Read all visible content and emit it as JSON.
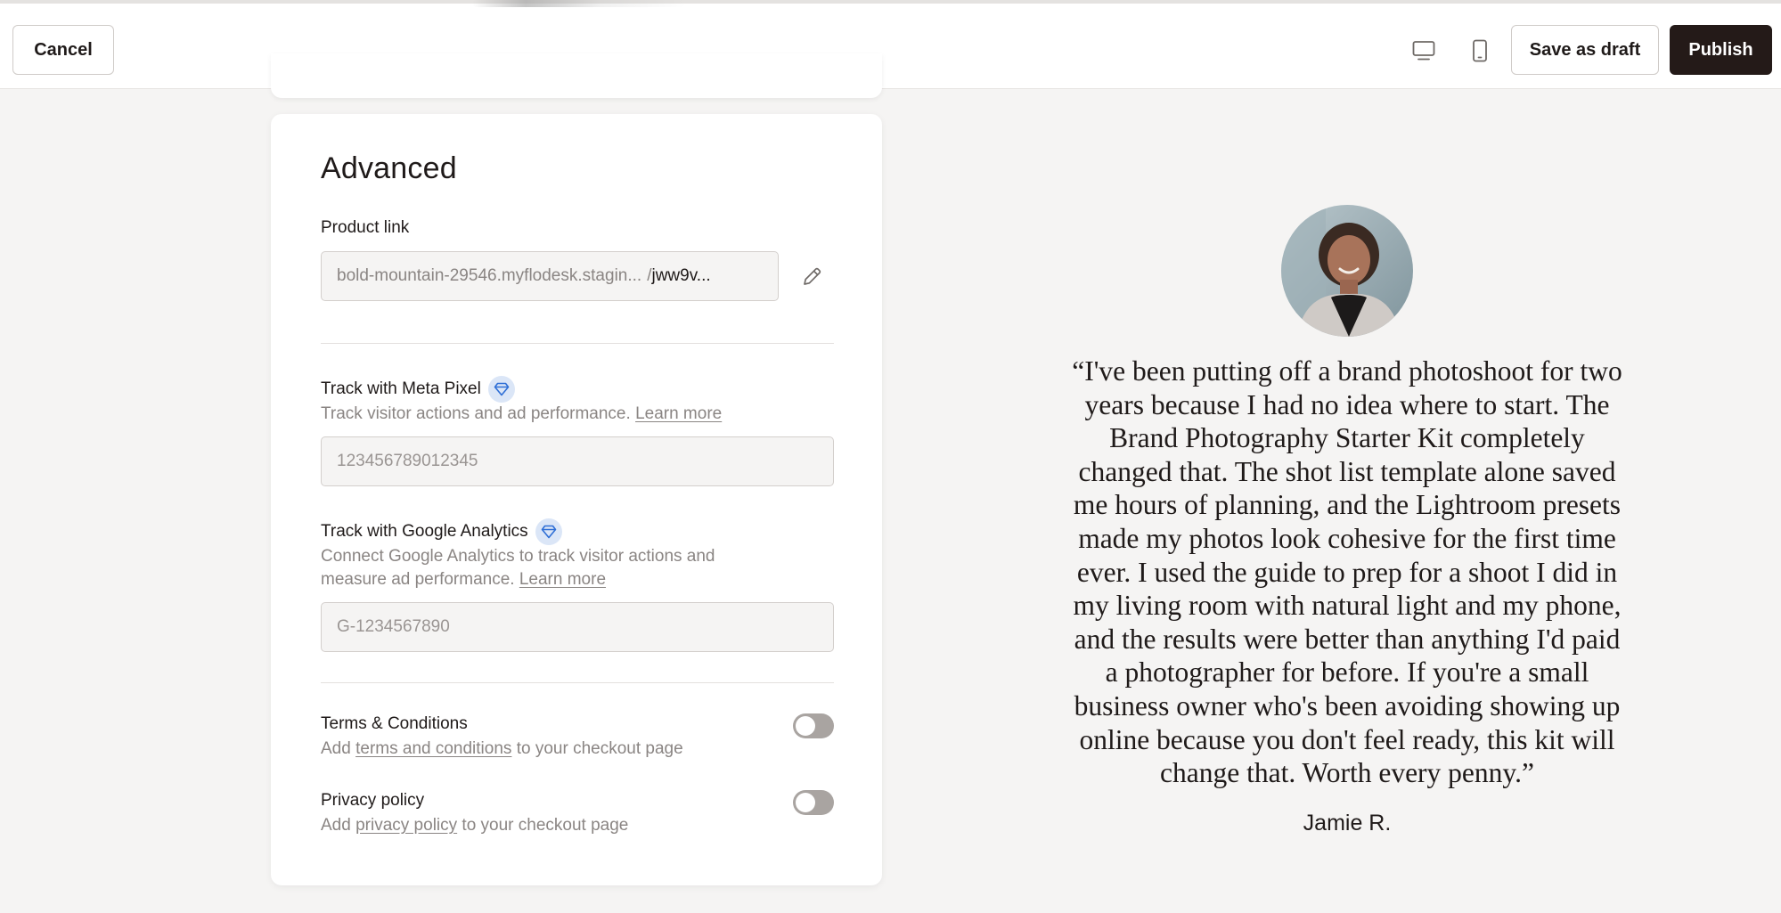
{
  "topbar": {
    "cancel_label": "Cancel",
    "save_draft_label": "Save as draft",
    "publish_label": "Publish",
    "desktop_icon": "desktop-icon",
    "mobile_icon": "mobile-icon"
  },
  "advanced": {
    "title": "Advanced",
    "product_link": {
      "label": "Product link",
      "domain": "bold-mountain-29546.myflodesk.stagin...",
      "separator": "/",
      "slug": "jww9v...",
      "edit_icon": "pencil-icon"
    },
    "meta_pixel": {
      "label": "Track with Meta Pixel",
      "badge_icon": "diamond-icon",
      "description": "Track visitor actions and ad performance.",
      "learn_more": "Learn more",
      "placeholder": "123456789012345"
    },
    "google_analytics": {
      "label": "Track with Google Analytics",
      "badge_icon": "diamond-icon",
      "description_line1": "Connect Google Analytics to track visitor actions and",
      "description_line2": "measure ad performance.",
      "learn_more": "Learn more",
      "placeholder": "G-1234567890"
    },
    "terms": {
      "label": "Terms & Conditions",
      "desc_prefix": "Add",
      "desc_link": "terms and conditions",
      "desc_suffix": "to your checkout page",
      "enabled": false
    },
    "privacy": {
      "label": "Privacy policy",
      "desc_prefix": "Add",
      "desc_link": "privacy policy",
      "desc_suffix": "to your checkout page",
      "enabled": false
    }
  },
  "preview": {
    "quote_lines": [
      "“I've been putting off a brand photoshoot for two",
      "years because I had no idea where to start. The",
      "Brand Photography Starter Kit completely",
      "changed that. The shot list template alone saved",
      "me hours of planning, and the Lightroom presets",
      "made my photos look cohesive for the first time",
      "ever. I used the guide to prep for a shoot I did in",
      "my living room with natural light and my phone,",
      "and the results were better than anything I'd paid",
      "a photographer for before. If you're a small",
      "business owner who's been avoiding showing up",
      "online because you don't feel ready, this kit will",
      "change that. Worth every penny.”"
    ],
    "author": "Jamie R."
  },
  "colors": {
    "background": "#f5f4f3",
    "publish_button": "#241a18",
    "badge_bg": "#dbe6f7",
    "badge_icon": "#2f6fd6",
    "toggle_off": "#a9a4a1"
  }
}
